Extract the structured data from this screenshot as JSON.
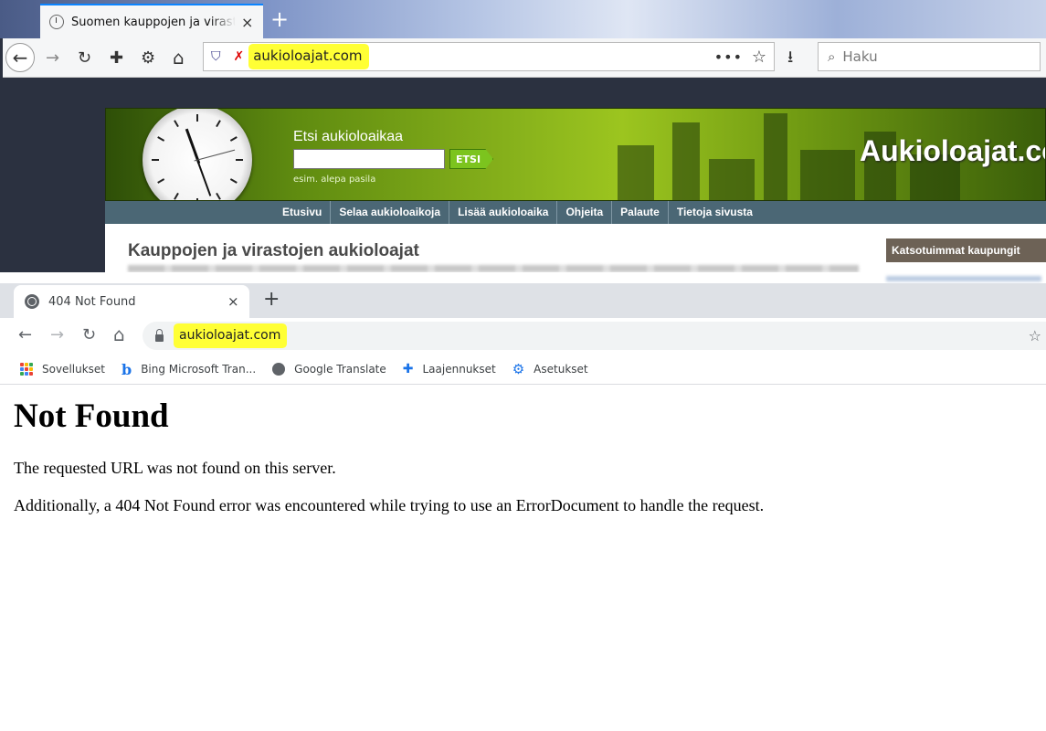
{
  "top_window": {
    "tab_title": "Suomen kauppojen ja virastojen aukioloajat",
    "tab_close": "×",
    "new_tab": "+",
    "url": "aukioloajat.com",
    "search_placeholder": "Haku",
    "icons": {
      "back": "←",
      "forward": "→",
      "reload": "↻",
      "extensions": "✚",
      "settings": "⚙",
      "home": "⌂",
      "shield": "⛉",
      "tracking": "✗",
      "page_actions": "•••",
      "bookmark_star": "☆",
      "library": "⭳",
      "search": "⌕"
    },
    "site": {
      "search_label": "Etsi aukioloaikaa",
      "search_button": "ETSI",
      "search_hint": "esim. alepa pasila",
      "logo": "Aukioloajat.com",
      "menu": [
        "Etusivu",
        "Selaa aukioloaikoja",
        "Lisää aukioloaika",
        "Ohjeita",
        "Palaute",
        "Tietoja sivusta"
      ],
      "heading": "Kauppojen ja virastojen aukioloajat",
      "sidebar_title": "Katsotuimmat kaupungit"
    }
  },
  "bottom_window": {
    "tab_title": "404 Not Found",
    "tab_close": "×",
    "new_tab": "+",
    "url": "aukioloajat.com",
    "icons": {
      "back": "←",
      "forward": "→",
      "reload": "↻",
      "home": "⌂",
      "star": "☆"
    },
    "bookmarks": [
      {
        "label": "Sovellukset"
      },
      {
        "label": "Bing Microsoft Tran..."
      },
      {
        "label": "Google Translate"
      },
      {
        "label": "Laajennukset"
      },
      {
        "label": "Asetukset"
      }
    ],
    "page": {
      "heading": "Not Found",
      "paragraph1": "The requested URL was not found on this server.",
      "paragraph2": "Additionally, a 404 Not Found error was encountered while trying to use an ErrorDocument to handle the request."
    }
  },
  "colors": {
    "url_highlight": "#ffff35",
    "firefox_accent": "#0a84ff",
    "site_green": "#8ab41c",
    "site_menu": "#4b6775",
    "chrome_tabbar": "#dee1e6",
    "chrome_blue": "#1a73e8"
  }
}
